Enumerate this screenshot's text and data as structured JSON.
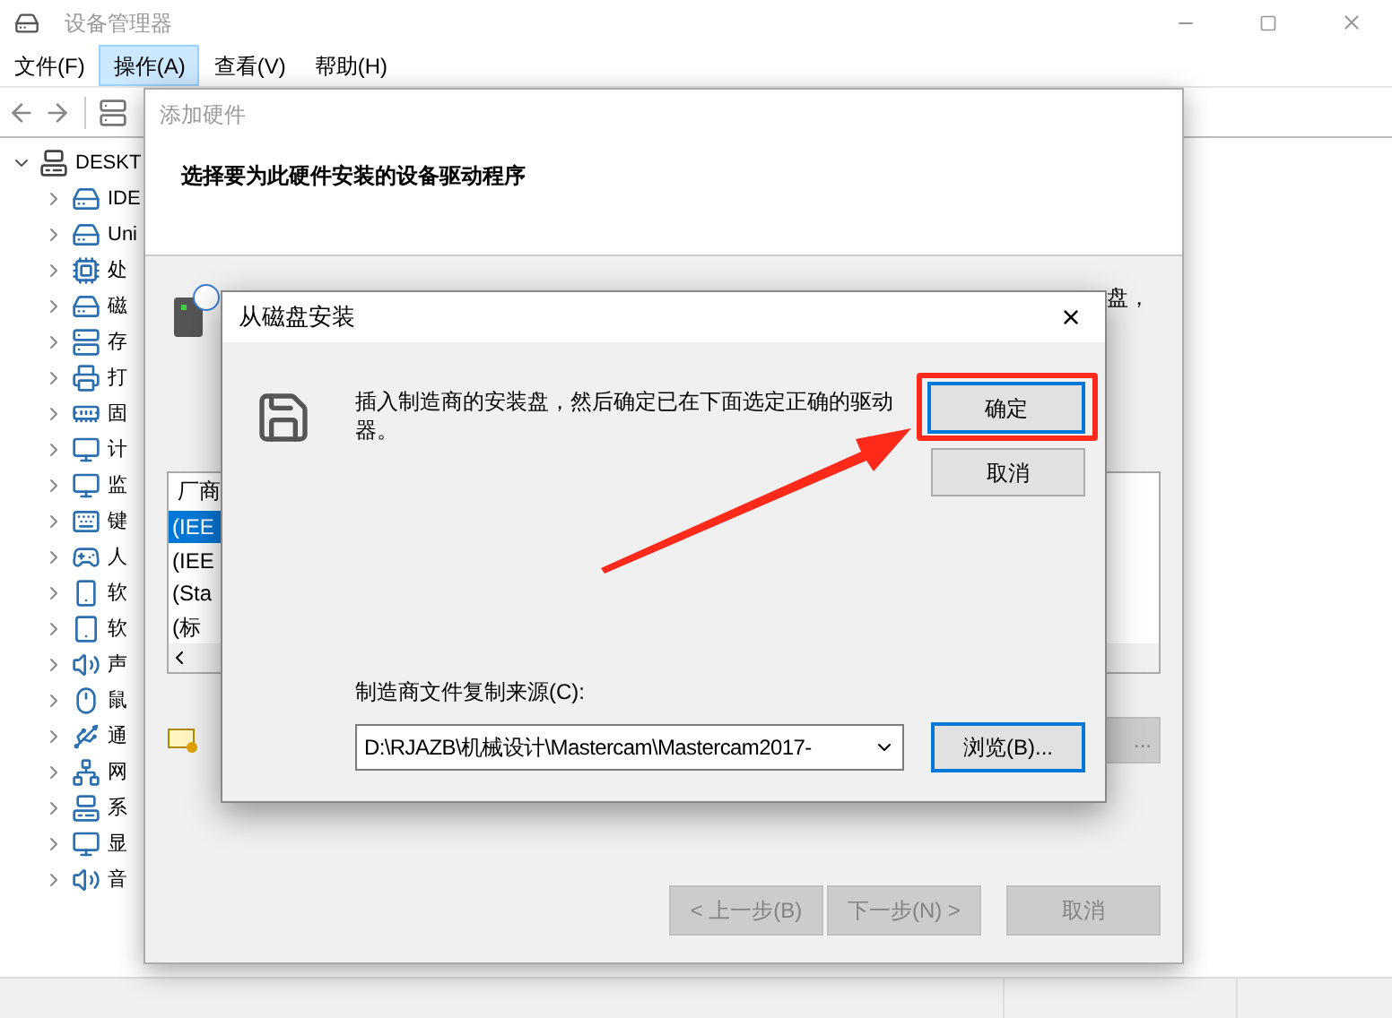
{
  "window": {
    "title": "设备管理器"
  },
  "menu": [
    {
      "label": "文件(F)",
      "selected": false
    },
    {
      "label": "操作(A)",
      "selected": true
    },
    {
      "label": "查看(V)",
      "selected": false
    },
    {
      "label": "帮助(H)",
      "selected": false
    }
  ],
  "tree": {
    "root": {
      "label": "DESKT",
      "expanded": true
    },
    "children": [
      {
        "label": "IDE"
      },
      {
        "label": "Uni"
      },
      {
        "label": "处"
      },
      {
        "label": "磁"
      },
      {
        "label": "存"
      },
      {
        "label": "打"
      },
      {
        "label": "固"
      },
      {
        "label": "计"
      },
      {
        "label": "监"
      },
      {
        "label": "键"
      },
      {
        "label": "人"
      },
      {
        "label": "软"
      },
      {
        "label": "软"
      },
      {
        "label": "声"
      },
      {
        "label": "鼠"
      },
      {
        "label": "通"
      },
      {
        "label": "网"
      },
      {
        "label": "系"
      },
      {
        "label": "显"
      },
      {
        "label": "音"
      }
    ]
  },
  "wizard": {
    "title": "添加硬件",
    "heading": "选择要为此硬件安装的设备驱动程序",
    "instruction_tail": "盘，",
    "list": {
      "column_1": "厂商",
      "items": [
        {
          "label": "(IEE",
          "selected": true
        },
        {
          "label": "(IEE",
          "selected": false
        },
        {
          "label": "(Sta",
          "selected": false
        },
        {
          "label": "(标",
          "selected": false
        }
      ]
    },
    "have_disk_button": {
      "label": "...",
      "disabled": true
    },
    "buttons": [
      {
        "label": "< 上一步(B)",
        "disabled": true
      },
      {
        "label": "下一步(N) >",
        "disabled": true
      },
      {
        "label": "取消",
        "disabled": true
      }
    ]
  },
  "dialog": {
    "title": "从磁盘安装",
    "close": "×",
    "message": "插入制造商的安装盘，然后确定已在下面选定正确的驱动器。",
    "ok_button": {
      "label": "确定",
      "default": true
    },
    "cancel_button": {
      "label": "取消"
    },
    "source_label": "制造商文件复制来源(C):",
    "source_value": "D:\\RJAZB\\机械设计\\Mastercam\\Mastercam2017-",
    "browse_button": {
      "label": "浏览(B)...",
      "focused": true
    }
  }
}
